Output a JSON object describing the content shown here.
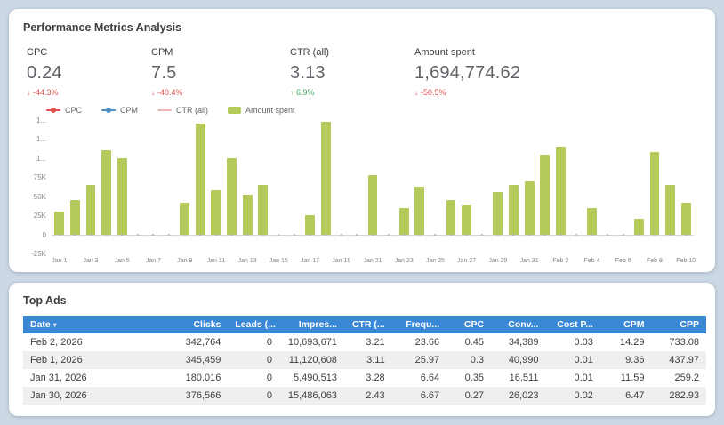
{
  "page": {
    "background": "#ccd8e4"
  },
  "colors": {
    "bar_green": "#b4ca5a",
    "table_header_blue": "#3a87d6",
    "delta_negative_red": "#e0514a",
    "delta_positive_green": "#3fa45b",
    "cpc_series": "#e0514a",
    "cpm_series": "#4a90c4",
    "ctr_series": "#f0b8b4"
  },
  "performance_panel": {
    "title": "Performance Metrics Analysis",
    "kpis": [
      {
        "label": "CPC",
        "value": "0.24",
        "delta": "-44.3%",
        "trend": "down"
      },
      {
        "label": "CPM",
        "value": "7.5",
        "delta": "-40.4%",
        "trend": "down"
      },
      {
        "label": "CTR (all)",
        "value": "3.13",
        "delta": "6.9%",
        "trend": "up"
      },
      {
        "label": "Amount spent",
        "value": "1,694,774.62",
        "delta": "-50.5%",
        "trend": "down"
      }
    ],
    "legend": [
      {
        "label": "CPC",
        "type": "line-dot",
        "color": "#e0514a"
      },
      {
        "label": "CPM",
        "type": "line-dot",
        "color": "#4a90c4"
      },
      {
        "label": "CTR (all)",
        "type": "line",
        "color": "#f0b8b4"
      },
      {
        "label": "Amount spent",
        "type": "swatch",
        "color": "#b4ca5a"
      }
    ]
  },
  "chart_data": {
    "type": "bar",
    "title": "Performance Metrics Analysis",
    "bar_series_name": "Amount spent",
    "bar_color": "#b4ca5a",
    "x": [
      "Jan 1",
      "Jan 2",
      "Jan 3",
      "Jan 4",
      "Jan 5",
      "Jan 6",
      "Jan 7",
      "Jan 8",
      "Jan 9",
      "Jan 10",
      "Jan 11",
      "Jan 12",
      "Jan 13",
      "Jan 14",
      "Jan 15",
      "Jan 16",
      "Jan 17",
      "Jan 18",
      "Jan 19",
      "Jan 20",
      "Jan 21",
      "Jan 22",
      "Jan 23",
      "Jan 24",
      "Jan 25",
      "Jan 26",
      "Jan 27",
      "Jan 28",
      "Jan 29",
      "Jan 30",
      "Jan 31",
      "Feb 1",
      "Feb 2",
      "Feb 3",
      "Feb 4",
      "Feb 5",
      "Feb 6",
      "Feb 7",
      "Feb 8",
      "Feb 9",
      "Feb 10"
    ],
    "values": [
      30000,
      45000,
      65000,
      110000,
      100000,
      0,
      0,
      0,
      42000,
      145000,
      58000,
      100000,
      52000,
      65000,
      0,
      0,
      25000,
      148000,
      0,
      0,
      78000,
      0,
      35000,
      62000,
      0,
      45000,
      38000,
      0,
      55000,
      65000,
      70000,
      105000,
      115000,
      0,
      35000,
      0,
      0,
      20000,
      108000,
      65000,
      42000
    ],
    "line_series": [
      {
        "name": "CPC",
        "approx_value": 0.24,
        "color": "#e0514a"
      },
      {
        "name": "CPM",
        "approx_value": 7.5,
        "color": "#4a90c4"
      },
      {
        "name": "CTR (all)",
        "approx_value": 3.13,
        "color": "#f0b8b4"
      }
    ],
    "ylim": [
      -25000,
      150000
    ],
    "y_ticks": [
      {
        "label": "1...",
        "value": 150000
      },
      {
        "label": "1...",
        "value": 125000
      },
      {
        "label": "1...",
        "value": 100000
      },
      {
        "label": "75K",
        "value": 75000
      },
      {
        "label": "50K",
        "value": 50000
      },
      {
        "label": "25K",
        "value": 25000
      },
      {
        "label": "0",
        "value": 0
      },
      {
        "label": "-25K",
        "value": -25000
      }
    ],
    "x_tick_labels": [
      "Jan 1",
      "Jan 3",
      "Jan 5",
      "Jan 7",
      "Jan 9",
      "Jan 11",
      "Jan 13",
      "Jan 15",
      "Jan 17",
      "Jan 19",
      "Jan 21",
      "Jan 23",
      "Jan 25",
      "Jan 27",
      "Jan 29",
      "Jan 31",
      "Feb 2",
      "Feb 4",
      "Feb 6",
      "Feb 8",
      "Feb 10"
    ],
    "legend_position": "top-left",
    "grid": false
  },
  "top_ads_panel": {
    "title": "Top Ads",
    "table": {
      "columns": [
        {
          "label": "Date",
          "sort": "desc"
        },
        {
          "label": "Clicks"
        },
        {
          "label": "Leads (..."
        },
        {
          "label": "Impres..."
        },
        {
          "label": "CTR (..."
        },
        {
          "label": "Frequ..."
        },
        {
          "label": "CPC"
        },
        {
          "label": "Conv..."
        },
        {
          "label": "Cost P..."
        },
        {
          "label": "CPM"
        },
        {
          "label": "CPP"
        }
      ],
      "rows": [
        [
          "Feb 2, 2026",
          "342,764",
          "0",
          "10,693,671",
          "3.21",
          "23.66",
          "0.45",
          "34,389",
          "0.03",
          "14.29",
          "733.08"
        ],
        [
          "Feb 1, 2026",
          "345,459",
          "0",
          "11,120,608",
          "3.11",
          "25.97",
          "0.3",
          "40,990",
          "0.01",
          "9.36",
          "437.97"
        ],
        [
          "Jan 31, 2026",
          "180,016",
          "0",
          "5,490,513",
          "3.28",
          "6.64",
          "0.35",
          "16,511",
          "0.01",
          "11.59",
          "259.2"
        ],
        [
          "Jan 30, 2026",
          "376,566",
          "0",
          "15,486,063",
          "2.43",
          "6.67",
          "0.27",
          "26,023",
          "0.02",
          "6.47",
          "282.93"
        ]
      ]
    }
  }
}
